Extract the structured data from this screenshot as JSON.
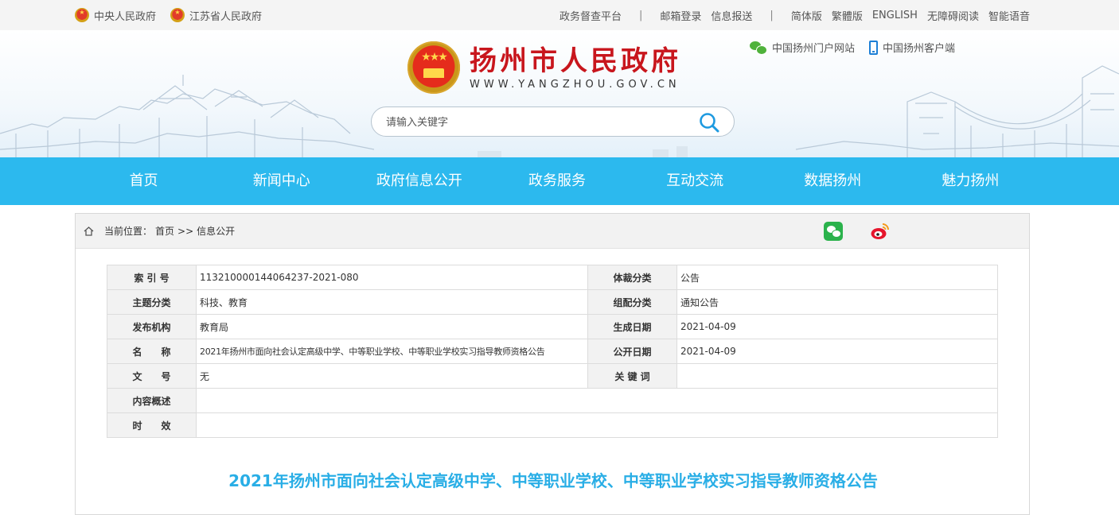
{
  "topbar": {
    "left_links": [
      "中央人民政府",
      "江苏省人民政府"
    ],
    "right_links": [
      "政务督查平台",
      "邮箱登录",
      "信息报送",
      "简体版",
      "繁體版",
      "ENGLISH",
      "无障碍阅读",
      "智能语音"
    ],
    "separator": "|"
  },
  "header": {
    "title": "扬州市人民政府",
    "url_text": "WWW.YANGZHOU.GOV.CN",
    "portal_links": [
      "中国扬州门户网站",
      "中国扬州客户端"
    ]
  },
  "search": {
    "placeholder": "请输入关键字"
  },
  "nav": {
    "items": [
      "首页",
      "新闻中心",
      "政府信息公开",
      "政务服务",
      "互动交流",
      "数据扬州",
      "魅力扬州"
    ]
  },
  "breadcrumb": {
    "label": "当前位置：",
    "home": "首页",
    "sep": ">>",
    "current": "信息公开"
  },
  "meta": {
    "index_label": "索 引 号",
    "index_value": "113210000144064237-2021-080",
    "genre_label": "体裁分类",
    "genre_value": "公告",
    "topic_label": "主题分类",
    "topic_value": "科技、教育",
    "category_label": "组配分类",
    "category_value": "通知公告",
    "org_label": "发布机构",
    "org_value": "教育局",
    "created_label": "生成日期",
    "created_value": "2021-04-09",
    "name_label": "名　　称",
    "name_value": "2021年扬州市面向社会认定高级中学、中等职业学校、中等职业学校实习指导教师资格公告",
    "published_label": "公开日期",
    "published_value": "2021-04-09",
    "docno_label": "文　　号",
    "docno_value": "无",
    "keyword_label": "关 键 词",
    "keyword_value": "",
    "summary_label": "内容概述",
    "summary_value": "",
    "validity_label": "时　　效",
    "validity_value": ""
  },
  "article": {
    "title": "2021年扬州市面向社会认定高级中学、中等职业学校、中等职业学校实习指导教师资格公告"
  },
  "colors": {
    "nav_bg": "#2cb9ee",
    "title_red": "#c8161d",
    "doc_title": "#29aee6"
  }
}
